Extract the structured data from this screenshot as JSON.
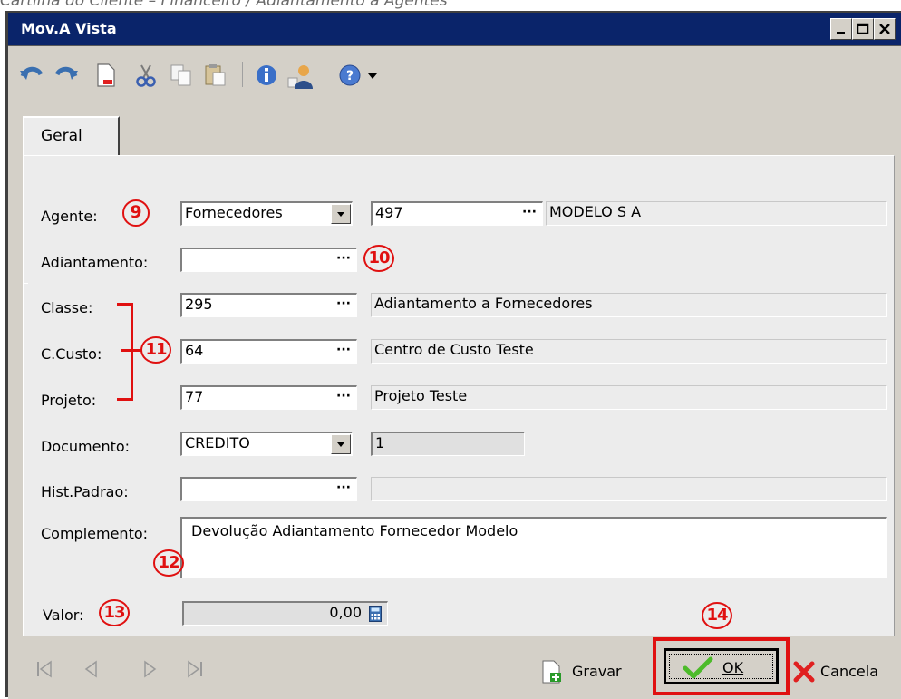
{
  "caption": "Cartilha do Cliente – Financeiro / Adiantamento a Agentes",
  "window": {
    "title": "Mov.A Vista",
    "minimize_glyph": "_",
    "maximize_glyph": "□",
    "close_glyph": "✕"
  },
  "toolbar": {
    "icons": [
      "undo-icon",
      "redo-icon",
      "new-document-icon",
      "cut-icon",
      "copy-icon",
      "paste-icon",
      "info-icon",
      "user-icon",
      "help-icon",
      "dropdown-arrow-icon"
    ]
  },
  "tabs": [
    {
      "label": "Geral",
      "active": true
    }
  ],
  "form": {
    "agente": {
      "label": "Agente:",
      "type_value": "Fornecedores",
      "code": "497",
      "description": "MODELO S A"
    },
    "adiantamento": {
      "label": "Adiantamento:",
      "value": ""
    },
    "classe": {
      "label": "Classe:",
      "code": "295",
      "description": "Adiantamento a Fornecedores"
    },
    "ccusto": {
      "label": "C.Custo:",
      "code": "64",
      "description": "Centro de Custo Teste"
    },
    "projeto": {
      "label": "Projeto:",
      "code": "77",
      "description": "Projeto Teste"
    },
    "documento": {
      "label": "Documento:",
      "type_value": "CREDITO",
      "number": "1"
    },
    "hist_padrao": {
      "label": "Hist.Padrao:",
      "value": "",
      "description": ""
    },
    "complemento": {
      "label": "Complemento:",
      "value": "Devolução Adiantamento Fornecedor Modelo"
    },
    "valor": {
      "label": "Valor:",
      "value": "0,00"
    },
    "ellipsis": "···"
  },
  "annotations": {
    "agente": "9",
    "adiantamento": "10",
    "classe_group": "11",
    "complemento": "12",
    "valor": "13",
    "ok": "14"
  },
  "footer": {
    "gravar_label": "Gravar",
    "ok_label": "OK",
    "cancela_label": "Cancela"
  },
  "colors": {
    "title_bar": "#0a246a",
    "annotation_red": "#e01010",
    "window_face": "#d4d0c8"
  }
}
